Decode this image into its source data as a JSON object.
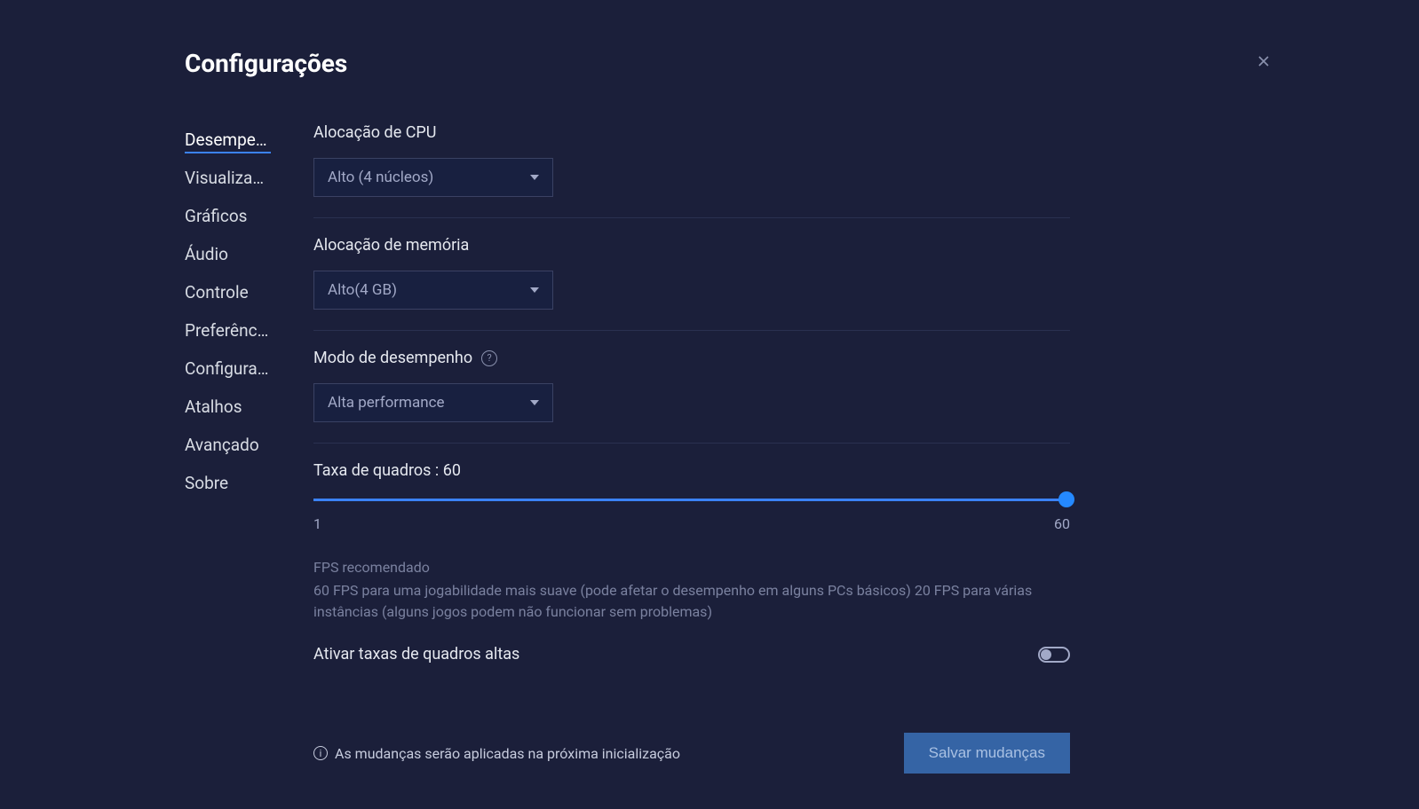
{
  "header": {
    "title": "Configurações"
  },
  "sidebar": {
    "items": [
      {
        "label": "Desempenho",
        "active": true
      },
      {
        "label": "Visualização"
      },
      {
        "label": "Gráficos"
      },
      {
        "label": "Áudio"
      },
      {
        "label": "Controle"
      },
      {
        "label": "Preferências"
      },
      {
        "label": "Configurações do disposit…"
      },
      {
        "label": "Atalhos"
      },
      {
        "label": "Avançado"
      },
      {
        "label": "Sobre"
      }
    ]
  },
  "content": {
    "cpu": {
      "label": "Alocação de CPU",
      "value": "Alto (4 núcleos)"
    },
    "memory": {
      "label": "Alocação de memória",
      "value": "Alto(4 GB)"
    },
    "performance": {
      "label": "Modo de desempenho",
      "value": "Alta performance"
    },
    "framerate": {
      "label": "Taxa de quadros : 60",
      "min": "1",
      "max": "60"
    },
    "fps_recommend": {
      "title": "FPS recomendado",
      "body": "60 FPS para uma jogabilidade mais suave (pode afetar o desempenho em alguns PCs básicos) 20 FPS para várias instâncias (alguns jogos podem não funcionar sem problemas)"
    },
    "high_fps_toggle": {
      "label": "Ativar taxas de quadros altas"
    }
  },
  "footer": {
    "note": "As mudanças serão aplicadas na próxima inicialização",
    "save_label": "Salvar mudanças"
  }
}
